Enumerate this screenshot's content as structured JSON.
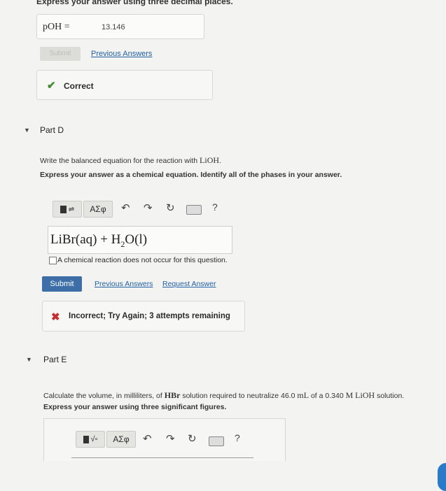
{
  "part_c": {
    "instruction": "Express your answer using three decimal places.",
    "answer_label": "pOH",
    "answer_equals": "=",
    "answer_value": "13.146",
    "submit_label": "Submit",
    "previous_answers": "Previous Answers",
    "feedback_text": "Correct"
  },
  "part_d": {
    "title": "Part D",
    "prompt_text": "Write the balanced equation for the reaction with ",
    "prompt_formula": "LiOH",
    "prompt_end": ".",
    "instruction": "Express your answer as a chemical equation. Identify all of the phases in your answer.",
    "toolbar": {
      "greek": "ΑΣφ",
      "help": "?"
    },
    "equation_main": "LiBr(aq) + H",
    "equation_sub": "2",
    "equation_end": "O(l)",
    "no_reaction_label": "A chemical reaction does not occur for this question.",
    "submit_label": "Submit",
    "previous_answers": "Previous Answers",
    "request_answer": "Request Answer",
    "feedback_text": "Incorrect; Try Again; 3 attempts remaining"
  },
  "part_e": {
    "title": "Part E",
    "prompt_1": "Calculate the volume, in milliliters, of ",
    "prompt_hbr": "HBr",
    "prompt_2": " solution required to neutralize 46.0 ",
    "prompt_ml": "mL",
    "prompt_3": " of a 0.340 ",
    "prompt_m": "M",
    "prompt_lioh": "LiOH",
    "prompt_4": " solution.",
    "instruction": "Express your answer using three significant figures.",
    "toolbar": {
      "greek": "ΑΣφ",
      "help": "?"
    }
  },
  "colors": {
    "link": "#2261a6",
    "submit": "#3d6ea8",
    "correct": "#3f8b2f",
    "incorrect": "#c62d2d"
  }
}
